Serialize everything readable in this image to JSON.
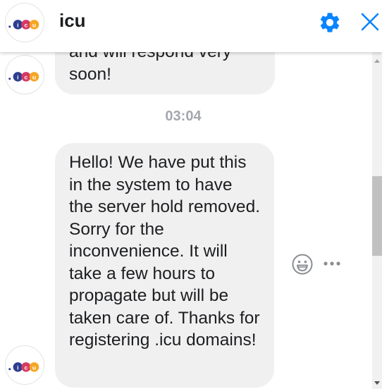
{
  "header": {
    "title": "icu",
    "logo_letters": [
      "i",
      "c",
      "u"
    ],
    "settings_icon": "gear-icon",
    "close_icon": "close-icon"
  },
  "colors": {
    "accent": "#0a84ff",
    "bubble_bg": "#f1f0f0",
    "logo_i": "#2d3e8f",
    "logo_c": "#d63a64",
    "logo_u": "#f5a623"
  },
  "messages": [
    {
      "text": "and will respond very soon!"
    },
    {
      "text": "Hello! We have put this in the system to have the server hold removed. Sorry for the inconvenience. It will take a few hours to propagate but will be taken care of. Thanks for registering .icu domains!"
    }
  ],
  "timestamp": "03:04",
  "actions": {
    "react_icon": "smiley-icon",
    "more_icon": "more-dots-icon"
  }
}
